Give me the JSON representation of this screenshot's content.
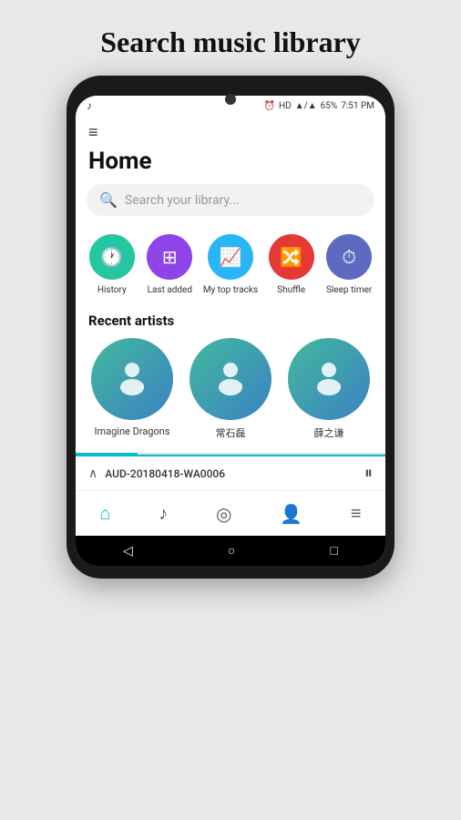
{
  "page": {
    "title": "Search music library"
  },
  "status_bar": {
    "music_note": "♪",
    "alarm_icon": "⏰",
    "hd_label": "HD",
    "signal": "▲",
    "battery": "65%",
    "time": "7:51 PM"
  },
  "app": {
    "hamburger": "≡",
    "home_title": "Home",
    "search_placeholder": "Search your library..."
  },
  "quick_actions": [
    {
      "id": "history",
      "label": "History",
      "color": "#26c6a0",
      "icon": "🕐"
    },
    {
      "id": "last-added",
      "label": "Last added",
      "color": "#8e44e8",
      "icon": "➕"
    },
    {
      "id": "top-tracks",
      "label": "My top tracks",
      "color": "#29b6f6",
      "icon": "📈"
    },
    {
      "id": "shuffle",
      "label": "Shuffle",
      "color": "#e53935",
      "icon": "🔀"
    },
    {
      "id": "sleep-timer",
      "label": "Sleep timer",
      "color": "#5c6bc0",
      "icon": "⏱"
    }
  ],
  "recent_artists": {
    "section_title": "Recent artists",
    "items": [
      {
        "id": "imagine-dragons",
        "name": "Imagine Dragons"
      },
      {
        "id": "chang-shi-lei",
        "name": "常石磊"
      },
      {
        "id": "xue-zhi-qian",
        "name": "薛之谦"
      }
    ]
  },
  "now_playing": {
    "expand_icon": "∧",
    "track": "AUD-20180418-WA0006",
    "pause_icon": "⏸"
  },
  "bottom_nav": [
    {
      "id": "home",
      "icon": "⌂",
      "active": true
    },
    {
      "id": "music",
      "icon": "♪",
      "active": false
    },
    {
      "id": "disc",
      "icon": "◎",
      "active": false
    },
    {
      "id": "profile",
      "icon": "👤",
      "active": false
    },
    {
      "id": "menu",
      "icon": "≡",
      "active": false
    }
  ],
  "android_nav": {
    "back": "◁",
    "home": "○",
    "recent": "□"
  }
}
